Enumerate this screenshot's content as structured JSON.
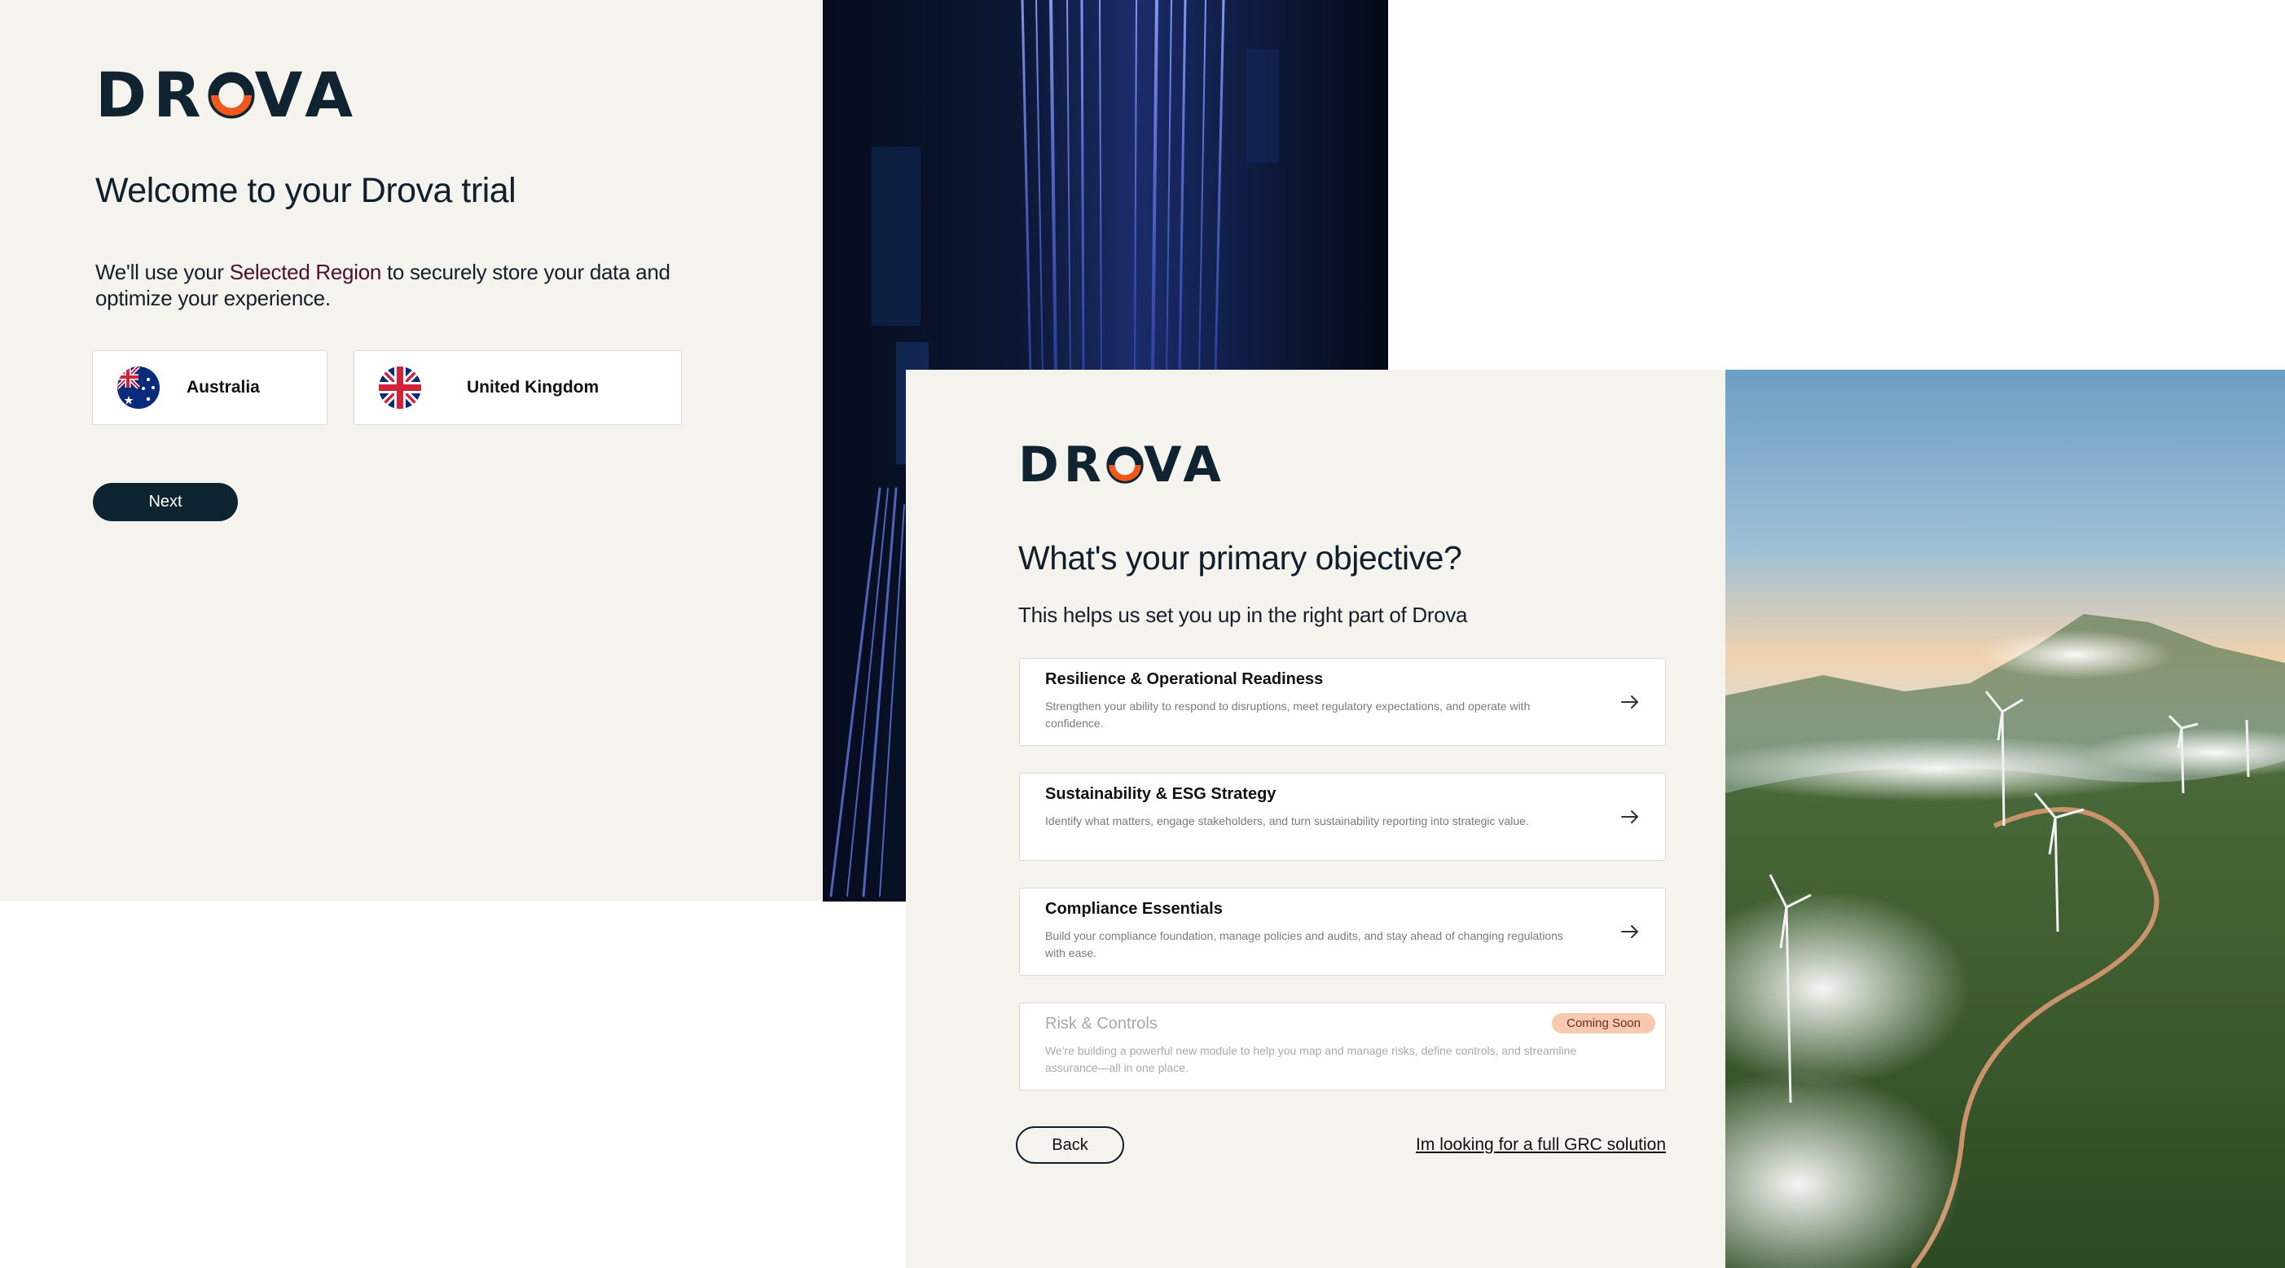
{
  "screen1": {
    "logo": "DROVA",
    "title": "Welcome to your Drova trial",
    "description_pre": "We'll use your ",
    "description_highlight": "Selected Region",
    "description_post": " to securely store your data and optimize your experience.",
    "regions": [
      {
        "label": "Australia",
        "flag": "australia-flag"
      },
      {
        "label": "United Kingdom",
        "flag": "uk-flag"
      }
    ],
    "next_label": "Next"
  },
  "screen2": {
    "logo": "DROVA",
    "title": "What's your primary objective?",
    "subtitle": "This helps us set you up in the right part of Drova",
    "objectives": [
      {
        "title": "Resilience & Operational Readiness",
        "description": "Strengthen your ability to respond to disruptions, meet regulatory expectations, and operate with confidence."
      },
      {
        "title": "Sustainability & ESG Strategy",
        "description": "Identify what matters, engage stakeholders, and turn sustainability reporting into strategic value."
      },
      {
        "title": "Compliance Essentials",
        "description": "Build your compliance foundation, manage policies and audits, and stay ahead of changing regulations with ease."
      },
      {
        "title": "Risk & Controls",
        "description": "We're building a powerful new module to help you map and manage risks, define controls, and streamline assurance—all in one place.",
        "badge": "Coming Soon"
      }
    ],
    "back_label": "Back",
    "grc_link": "Im looking for a full GRC solution"
  },
  "colors": {
    "background": "#f5f3ee",
    "primary_dark": "#0d2330",
    "logo_accent": "#f0581e",
    "badge": "#f7c9b0"
  }
}
